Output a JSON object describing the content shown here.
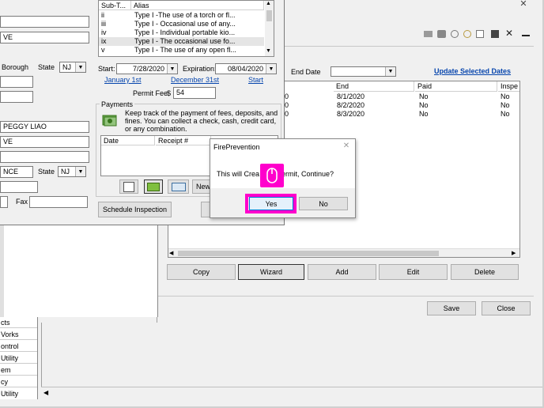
{
  "left_form": {
    "street1": "VE",
    "city": "Borough",
    "state_label": "State",
    "state_value": "NJ",
    "owner_name": "PEGGY LIAO",
    "owner_street": "VE",
    "owner_city": "NCE",
    "owner_state_label": "State",
    "owner_state_value": "NJ",
    "fax_label": "Fax"
  },
  "subtype_list": {
    "col1": "Sub-T...",
    "col2": "Alias",
    "rows": [
      {
        "code": "ii",
        "alias": "Type I -The use of a torch or fl..."
      },
      {
        "code": "iii",
        "alias": "Type I - Occasional use of any..."
      },
      {
        "code": "iv",
        "alias": "Type I - Individual portable kio..."
      },
      {
        "code": "ix",
        "alias": "Type I - The occasional use fo..."
      },
      {
        "code": "v",
        "alias": "Type I - The use of any open fl..."
      }
    ]
  },
  "dates": {
    "start_label": "Start:",
    "start_value": "7/28/2020",
    "expiration_label": "Expiration:",
    "expiration_value": "08/04/2020",
    "link_jan": "January 1st",
    "link_dec": "December 31st",
    "link_start": "Start",
    "fee_label": "Permit Fee",
    "fee_currency": "$",
    "fee_value": "54"
  },
  "payments": {
    "group_label": "Payments",
    "description": "Keep track of the payment of fees, deposits, and fines. You can collect a check, cash, credit card, or any combination.",
    "col_date": "Date",
    "col_receipt": "Receipt #",
    "new_button": "New",
    "schedule_button": "Schedule Inspection"
  },
  "permit_window": {
    "end_date_label": "End Date",
    "update_link": "Update Selected Dates",
    "columns": [
      "End",
      "Paid",
      "Inspe"
    ],
    "rows": [
      {
        "left": "0",
        "end": "8/1/2020",
        "paid": "No",
        "insp": "No"
      },
      {
        "left": "0",
        "end": "8/2/2020",
        "paid": "No",
        "insp": "No"
      },
      {
        "left": "0",
        "end": "8/3/2020",
        "paid": "No",
        "insp": "No"
      }
    ],
    "buttons": {
      "copy": "Copy",
      "wizard": "Wizard",
      "add": "Add",
      "edit": "Edit",
      "delete": "Delete"
    },
    "save": "Save",
    "close": "Close"
  },
  "dialog": {
    "title": "FirePrevention",
    "message": "This will Crea",
    "message_tail": "ermit, Continue?",
    "yes": "Yes",
    "no": "No",
    "highlight_color": "#ff00cc"
  },
  "nav_list": [
    "cts",
    "Vorks",
    "ontrol",
    "Utility",
    "em",
    "cy",
    "Utility"
  ]
}
